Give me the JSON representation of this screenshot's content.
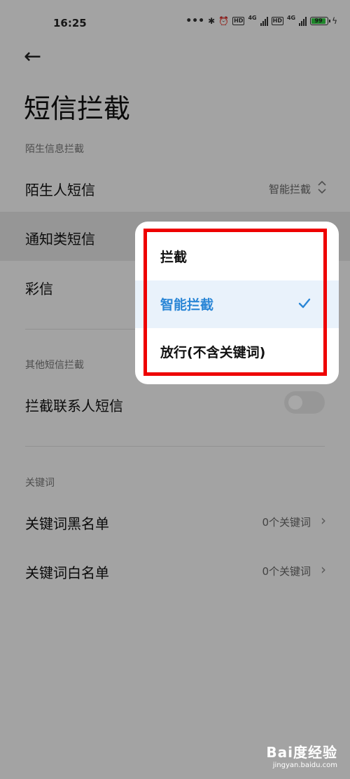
{
  "status_bar": {
    "time": "16:25",
    "battery": "99",
    "network": "4G",
    "hd": "HD"
  },
  "page_title": "短信拦截",
  "sections": [
    {
      "label": "陌生信息拦截",
      "rows": [
        {
          "label": "陌生人短信",
          "value": "智能拦截"
        },
        {
          "label": "通知类短信"
        },
        {
          "label": "彩信"
        }
      ]
    },
    {
      "label": "其他短信拦截",
      "rows": [
        {
          "label": "拦截联系人短信"
        }
      ]
    },
    {
      "label": "关键词",
      "rows": [
        {
          "label": "关键词黑名单",
          "value": "0个关键词"
        },
        {
          "label": "关键词白名单",
          "value": "0个关键词"
        }
      ]
    }
  ],
  "popup": {
    "options": [
      "拦截",
      "智能拦截",
      "放行(不含关键词)"
    ],
    "selected": "智能拦截"
  },
  "watermark": {
    "line1": "Bai度经验",
    "line2": "jingyan.baidu.com"
  },
  "colors": {
    "accent": "#2a86d6",
    "annotation": "#e00000"
  }
}
